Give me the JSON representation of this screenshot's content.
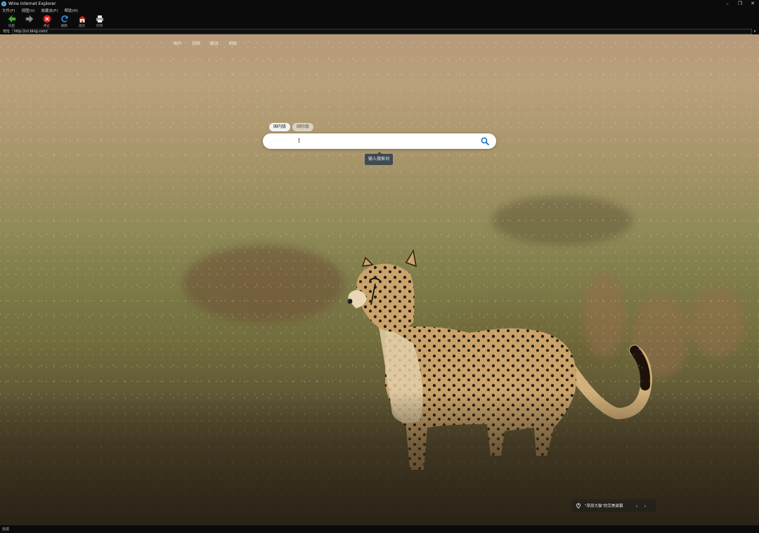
{
  "window": {
    "title": "Wine Internet Explorer",
    "controls": {
      "minimize": "–",
      "restore": "❐",
      "close": "✕"
    }
  },
  "menu": [
    "文件(F)",
    "视图(V)",
    "收藏夹(F)",
    "帮助(H)"
  ],
  "toolbar": {
    "back": {
      "label": "向后",
      "icon": "back-arrow-icon"
    },
    "forward": {
      "label": "",
      "icon": "forward-arrow-icon"
    },
    "stop": {
      "label": "停止",
      "icon": "stop-icon"
    },
    "refresh": {
      "label": "刷新",
      "icon": "refresh-icon"
    },
    "home": {
      "label": "首页",
      "icon": "home-icon"
    },
    "print": {
      "label": "打印",
      "icon": "print-icon"
    }
  },
  "address": {
    "label": "地址",
    "url": "http://cn.bing.com/"
  },
  "page": {
    "nav_links": [
      "图片",
      "视频",
      "翻译",
      "地图",
      "···"
    ],
    "tabs": {
      "domestic": "国内版",
      "international": "国际版"
    },
    "search_placeholder": "",
    "tooltip": "输入搜索词",
    "image_caption": "\"草原大猫\"的完美谢幕",
    "colors": {
      "brand": "#0067b8",
      "tooltip_bg": "#3f4a52"
    }
  },
  "status": {
    "text": "完成"
  }
}
